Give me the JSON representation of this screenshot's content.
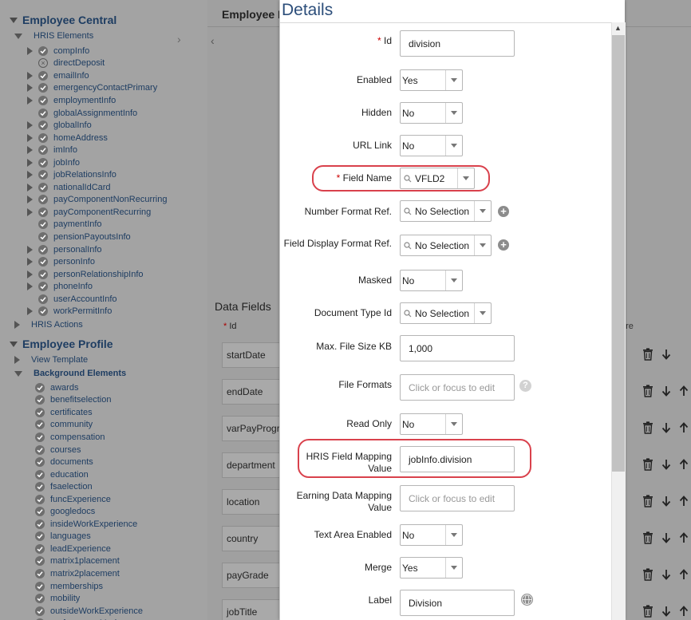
{
  "tree": {
    "employee_central": "Employee Central",
    "hris_elements": "HRIS Elements",
    "hris_items": [
      {
        "label": "compInfo",
        "expand": true,
        "icon": "check"
      },
      {
        "label": "directDeposit",
        "expand": false,
        "icon": "x"
      },
      {
        "label": "emailInfo",
        "expand": true,
        "icon": "check"
      },
      {
        "label": "emergencyContactPrimary",
        "expand": true,
        "icon": "check"
      },
      {
        "label": "employmentInfo",
        "expand": true,
        "icon": "check"
      },
      {
        "label": "globalAssignmentInfo",
        "expand": false,
        "icon": "check"
      },
      {
        "label": "globalInfo",
        "expand": true,
        "icon": "check"
      },
      {
        "label": "homeAddress",
        "expand": true,
        "icon": "check"
      },
      {
        "label": "imInfo",
        "expand": true,
        "icon": "check"
      },
      {
        "label": "jobInfo",
        "expand": true,
        "icon": "check"
      },
      {
        "label": "jobRelationsInfo",
        "expand": true,
        "icon": "check"
      },
      {
        "label": "nationalIdCard",
        "expand": true,
        "icon": "check"
      },
      {
        "label": "payComponentNonRecurring",
        "expand": true,
        "icon": "check"
      },
      {
        "label": "payComponentRecurring",
        "expand": true,
        "icon": "check"
      },
      {
        "label": "paymentInfo",
        "expand": false,
        "icon": "check"
      },
      {
        "label": "pensionPayoutsInfo",
        "expand": false,
        "icon": "check"
      },
      {
        "label": "personalInfo",
        "expand": true,
        "icon": "check"
      },
      {
        "label": "personInfo",
        "expand": true,
        "icon": "check"
      },
      {
        "label": "personRelationshipInfo",
        "expand": true,
        "icon": "check"
      },
      {
        "label": "phoneInfo",
        "expand": true,
        "icon": "check"
      },
      {
        "label": "userAccountInfo",
        "expand": false,
        "icon": "check"
      },
      {
        "label": "workPermitInfo",
        "expand": true,
        "icon": "check"
      }
    ],
    "hris_actions": "HRIS Actions",
    "employee_profile": "Employee Profile",
    "view_template": "View Template",
    "background_elements": "Background Elements",
    "bg_items": [
      "awards",
      "benefitselection",
      "certificates",
      "community",
      "compensation",
      "courses",
      "documents",
      "education",
      "fsaelection",
      "funcExperience",
      "googledocs",
      "insideWorkExperience",
      "languages",
      "leadExperience",
      "matrix1placement",
      "matrix2placement",
      "memberships",
      "mobility",
      "outsideWorkExperience",
      "performanceMarks"
    ]
  },
  "background": {
    "title": "Employee I",
    "data_fields_title": "Data Fields",
    "id_header": "Id",
    "more_header": "ore",
    "rows": [
      {
        "value": "startDate",
        "up": false
      },
      {
        "value": "endDate",
        "up": true
      },
      {
        "value": "varPayProgra",
        "up": true
      },
      {
        "value": "department",
        "up": true
      },
      {
        "value": "location",
        "up": true
      },
      {
        "value": "country",
        "up": true
      },
      {
        "value": "payGrade",
        "up": true
      },
      {
        "value": "jobTitle",
        "up": true
      }
    ]
  },
  "dialog": {
    "title": "Details",
    "id_label": "Id",
    "id_value": "division",
    "enabled_label": "Enabled",
    "enabled_value": "Yes",
    "hidden_label": "Hidden",
    "hidden_value": "No",
    "url_link_label": "URL Link",
    "url_link_value": "No",
    "field_name_label": "Field Name",
    "field_name_value": "VFLD2",
    "number_format_label": "Number Format Ref.",
    "number_format_value": "No Selection",
    "field_display_label": "Field Display Format Ref.",
    "field_display_value": "No Selection",
    "masked_label": "Masked",
    "masked_value": "No",
    "doc_type_label": "Document Type Id",
    "doc_type_value": "No Selection",
    "max_file_label": "Max. File Size KB",
    "max_file_value": "1,000",
    "file_formats_label": "File Formats",
    "file_formats_placeholder": "Click or focus to edit",
    "read_only_label": "Read Only",
    "read_only_value": "No",
    "hris_mapping_label": "HRIS Field Mapping Value",
    "hris_mapping_value": "jobInfo.division",
    "earning_label": "Earning Data Mapping Value",
    "earning_placeholder": "Click or focus to edit",
    "text_area_label": "Text Area Enabled",
    "text_area_value": "No",
    "merge_label": "Merge",
    "merge_value": "Yes",
    "label_label": "Label",
    "label_value": "Division",
    "required_mark": "*"
  },
  "colors": {
    "highlight": "#d9414c",
    "link": "#1e3d62",
    "title": "#2c4e7a"
  }
}
